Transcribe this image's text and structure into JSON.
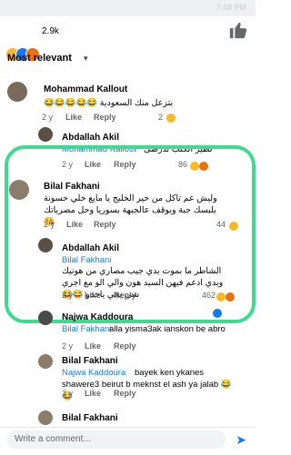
{
  "status": {
    "time": "7:48 PM"
  },
  "reactions": {
    "count": "2.9k"
  },
  "filter": {
    "label": "Most relevant"
  },
  "comments": [
    {
      "name": "Mohammad Kallout",
      "text": "بتزعل منك السعودية 😂😂😂😂😂",
      "time": "2 y",
      "like": "Like",
      "reply": "Reply",
      "count": "2"
    },
    {
      "name": "Abdallah Akil",
      "tag": "Mohammad Kallout",
      "text": "لطيز الكلب تدرضى",
      "time": "2 y",
      "like": "Like",
      "reply": "Reply",
      "count": "86"
    },
    {
      "name": "Bilal Fakhani",
      "text": "وليش عم تاكل من خير الخليج يا مايع خلي حسونة يلبسك جبة ويوقف عالجبهة بسوريا وحل مصرياتك 😘",
      "time": "2 y",
      "like": "Like",
      "reply": "Reply",
      "count": "44"
    },
    {
      "name": "Abdallah Akil",
      "tag": "Bilal Fakhani",
      "text": "الشاطر ما بموت بدي جيب مصاري من هونيك وبدي ادعم فيهن السيد هون والي الو مع اجري شي يجي ياخدو 😂😂",
      "time": "2 y",
      "like": "Like",
      "reply": "Reply",
      "count": "462"
    },
    {
      "name": "Najwa Kaddoura",
      "tag": "Bilal Fakhani",
      "text": "alla yisma3ak ianskon  be abro",
      "time": "2 y",
      "like": "Like",
      "reply": "Reply"
    },
    {
      "name": "Bilal Fakhani",
      "tag": "Najwa Kaddoura",
      "text": "bayek ken ykanes shawere3 beirut b meknst el ash ya jalab 😂😂",
      "time": "2 y",
      "like": "Like",
      "reply": "Reply"
    },
    {
      "name": "Bilal Fakhani",
      "text": "",
      "time": "",
      "like": "",
      "reply": ""
    }
  ],
  "composer": {
    "placeholder": "Write a comment..."
  },
  "colors": {
    "accent": "#1877f2",
    "highlight": "#3cdc8c"
  }
}
